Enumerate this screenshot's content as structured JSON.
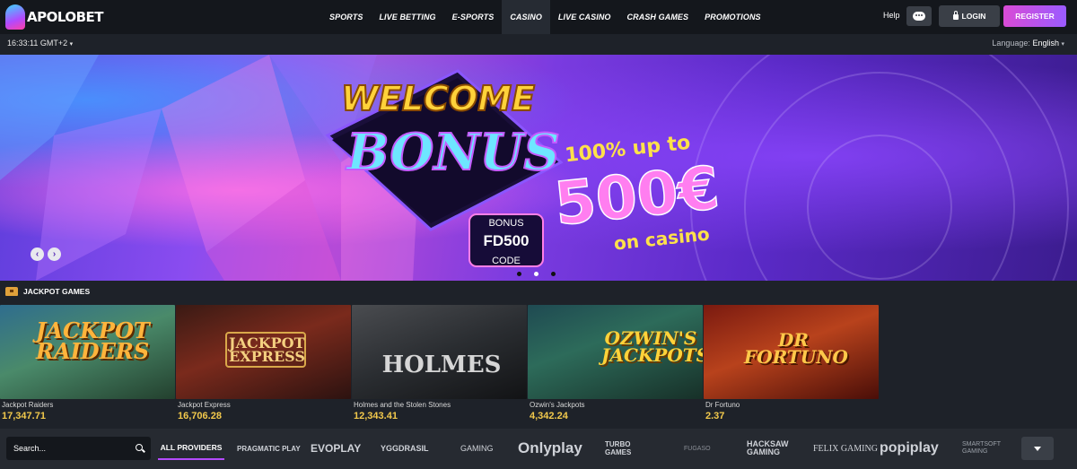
{
  "brand": {
    "name": "APOLOBET"
  },
  "nav": [
    {
      "label": "SPORTS",
      "active": false
    },
    {
      "label": "LIVE BETTING",
      "active": false
    },
    {
      "label": "E-SPORTS",
      "active": false
    },
    {
      "label": "CASINO",
      "active": true
    },
    {
      "label": "LIVE CASINO",
      "active": false
    },
    {
      "label": "CRASH GAMES",
      "active": false
    },
    {
      "label": "PROMOTIONS",
      "active": false
    }
  ],
  "header": {
    "help": "Help",
    "login": "LOGIN",
    "register": "REGISTER"
  },
  "subbar": {
    "clock": "16:33:11 GMT+2",
    "language_label": "Language:",
    "language_value": "English"
  },
  "banner": {
    "headline_1": "WELCOME",
    "headline_2": "BONUS",
    "code_top": "BONUS",
    "code": "FD500",
    "code_bottom": "CODE",
    "offer_1": "100% up to",
    "offer_2": "500€",
    "offer_3": "on casino",
    "slides_total": 3,
    "active_slide": 2
  },
  "jackpot": {
    "title": "JACKPOT GAMES",
    "games": [
      {
        "name": "Jackpot Raiders",
        "amount": "17,347.71",
        "art": "JACKPOT RAIDERS"
      },
      {
        "name": "Jackpot Express",
        "amount": "16,706.28",
        "art": "JACKPOT EXPRESS"
      },
      {
        "name": "Holmes and the Stolen Stones",
        "amount": "12,343.41",
        "art": "HOLMES"
      },
      {
        "name": "Ozwin's Jackpots",
        "amount": "4,342.24",
        "art": "OZWIN'S JACKPOTS"
      },
      {
        "name": "Dr Fortuno",
        "amount": "2.37",
        "art": "DR FORTUNO"
      }
    ]
  },
  "providers": {
    "search_placeholder": "Search...",
    "all_label": "ALL PROVIDERS",
    "list": [
      "PRAGMATIC PLAY",
      "EVOPLAY",
      "YGGDRASIL",
      "GAMING",
      "Onlyplay",
      "TURBO GAMES",
      "FUGASO",
      "HACKSAW GAMING",
      "FELIX GAMING",
      "popiplay",
      "SMARTSOFT GAMING"
    ]
  },
  "colors": {
    "accent": "#b44bff",
    "jackpot_amount": "#f2c94c",
    "register_start": "#d94bd6",
    "register_end": "#9b5bff"
  }
}
